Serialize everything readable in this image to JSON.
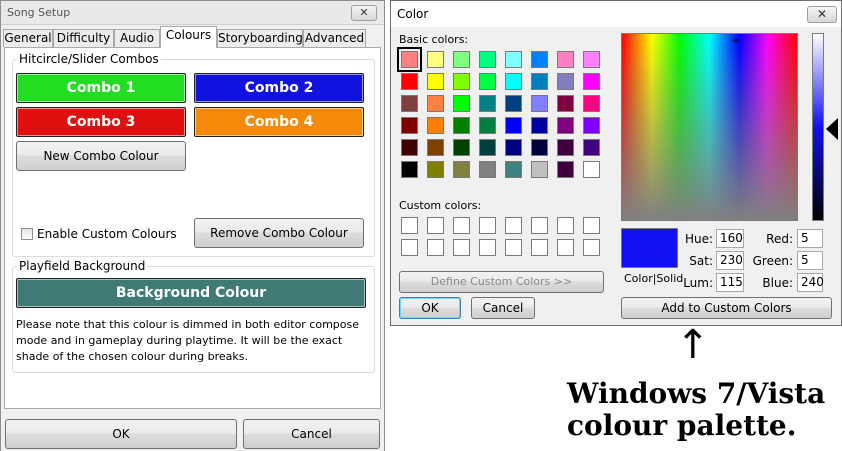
{
  "song_setup": {
    "title": "Song Setup",
    "close_glyph": "✕",
    "tabs": [
      "General",
      "Difficulty",
      "Audio",
      "Colours",
      "Storyboarding",
      "Advanced"
    ],
    "active_tab": "Colours",
    "combos_group": "Hitcircle/Slider Combos",
    "combos": [
      {
        "label": "Combo 1",
        "color": "#22dd22"
      },
      {
        "label": "Combo 2",
        "color": "#1111e0"
      },
      {
        "label": "Combo 3",
        "color": "#e01010"
      },
      {
        "label": "Combo 4",
        "color": "#f58a0a"
      }
    ],
    "new_combo_label": "New Combo Colour",
    "enable_custom_label": "Enable Custom Colours",
    "remove_combo_label": "Remove Combo Colour",
    "playfield_group": "Playfield Background",
    "background_button_label": "Background Colour",
    "background_color": "#3f7a74",
    "note": "Please note that this colour is dimmed in both editor compose mode and in gameplay during playtime.  It will be the exact shade of the chosen colour during breaks.",
    "ok_label": "OK",
    "cancel_label": "Cancel"
  },
  "color_dialog": {
    "title": "Color",
    "close_glyph": "✕",
    "basic_label": "Basic colors:",
    "basic_colors": [
      "#ff8080",
      "#ffff80",
      "#80ff80",
      "#00ff80",
      "#80ffff",
      "#0080ff",
      "#ff80c0",
      "#ff80ff",
      "#ff0000",
      "#ffff00",
      "#80ff00",
      "#00ff40",
      "#00ffff",
      "#0080c0",
      "#8080c0",
      "#ff00ff",
      "#804040",
      "#ff8040",
      "#00ff00",
      "#008080",
      "#004080",
      "#8080ff",
      "#800040",
      "#ff0080",
      "#800000",
      "#ff8000",
      "#008000",
      "#008040",
      "#0000ff",
      "#0000a0",
      "#800080",
      "#8000ff",
      "#400000",
      "#804000",
      "#004000",
      "#004040",
      "#000080",
      "#000040",
      "#400040",
      "#400080",
      "#000000",
      "#808000",
      "#808040",
      "#808080",
      "#408080",
      "#c0c0c0",
      "#400040",
      "#ffffff"
    ],
    "custom_label": "Custom colors:",
    "define_custom_label": "Define Custom Colors >>",
    "ok_label": "OK",
    "cancel_label": "Cancel",
    "preview_color": "#1010f0",
    "color_solid_label": "Color|Solid",
    "hue_label": "Hue:",
    "hue": "160",
    "sat_label": "Sat:",
    "sat": "230",
    "lum_label": "Lum:",
    "lum": "115",
    "red_label": "Red:",
    "red": "5",
    "green_label": "Green:",
    "green": "5",
    "blue_label": "Blue:",
    "blue": "240",
    "add_custom_label": "Add to Custom Colors"
  },
  "annotation": {
    "arrow_glyph": "↑",
    "caption_line1": "Windows 7/Vista",
    "caption_line2": "colour palette."
  }
}
